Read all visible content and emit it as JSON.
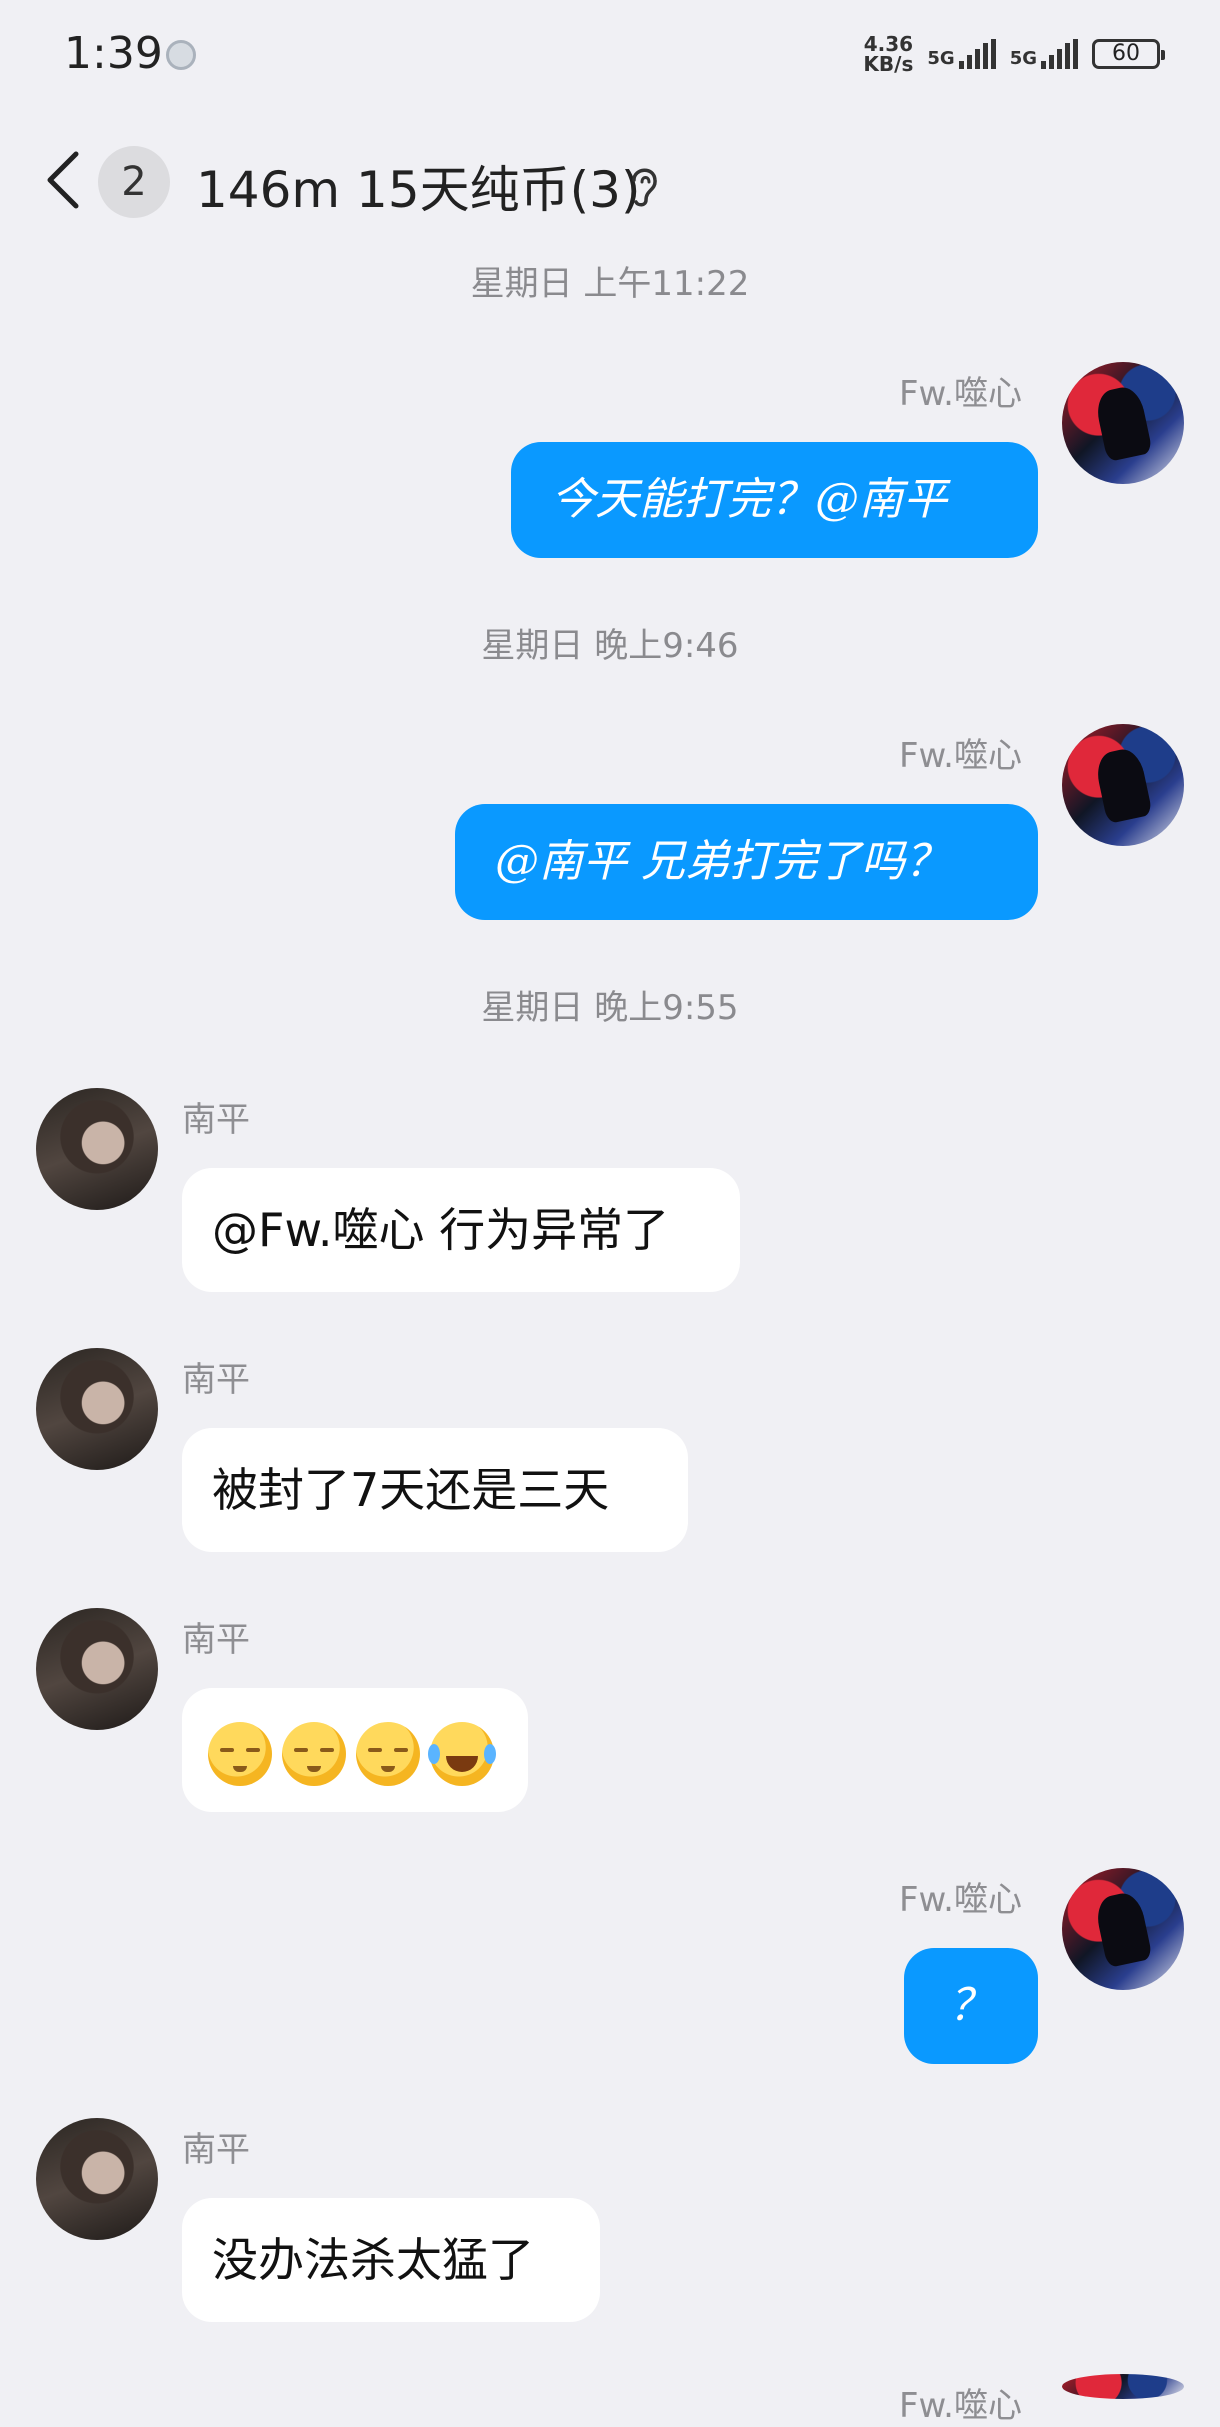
{
  "status_bar": {
    "time": "1:39",
    "net_speed_value": "4.36",
    "net_speed_unit": "KB/s",
    "signal_1_label": "5G",
    "signal_2_label": "5G",
    "battery": "60"
  },
  "header": {
    "unread_count": "2",
    "title": "146m 15天纯币(3)",
    "icons": {
      "back": "chevron-left-icon",
      "ear": "ear-icon"
    }
  },
  "messages": [
    {
      "type": "time",
      "text": "星期日 上午11:22"
    },
    {
      "type": "mine",
      "sender": "Fw.噬心",
      "text": "今天能打完？@南平"
    },
    {
      "type": "time",
      "text": "星期日 晚上9:46"
    },
    {
      "type": "mine",
      "sender": "Fw.噬心",
      "text": "@南平 兄弟打完了吗？"
    },
    {
      "type": "time",
      "text": "星期日 晚上9:55"
    },
    {
      "type": "theirs",
      "sender": "南平",
      "text": "@Fw.噬心 行为异常了"
    },
    {
      "type": "theirs",
      "sender": "南平",
      "text": "被封了7天还是三天"
    },
    {
      "type": "theirs",
      "sender": "南平",
      "emojis": [
        "sleepy",
        "sleepy",
        "sleepy",
        "laugh-crying"
      ]
    },
    {
      "type": "mine",
      "sender": "Fw.噬心",
      "text": "？"
    },
    {
      "type": "theirs",
      "sender": "南平",
      "text": "没办法杀太猛了"
    },
    {
      "type": "mine",
      "sender": "Fw.噬心"
    }
  ],
  "colors": {
    "my_bubble": "#0a99ff",
    "their_bubble": "#ffffff",
    "background": "#f0f0f4"
  }
}
